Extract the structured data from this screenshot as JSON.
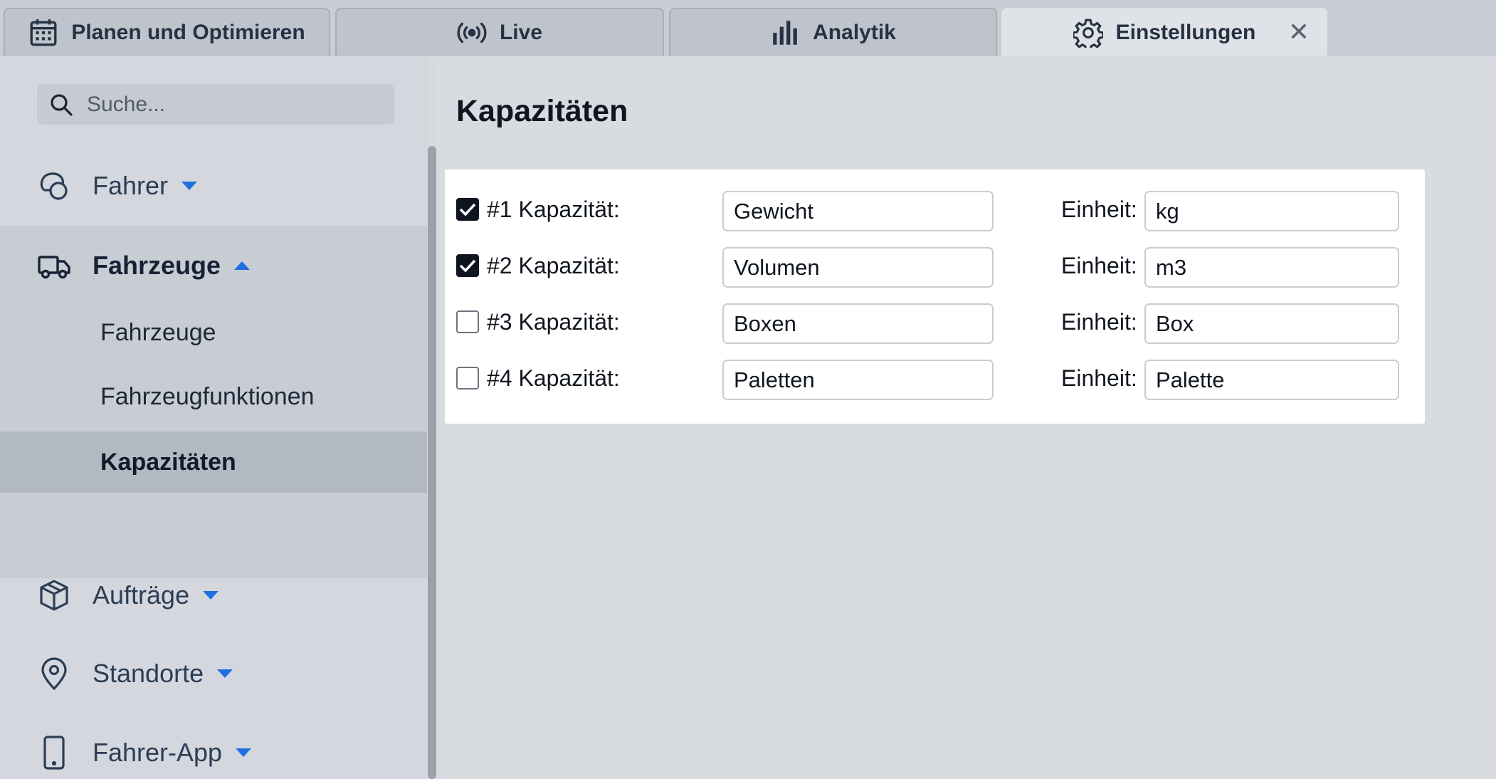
{
  "tabs": [
    {
      "label": "Planen und Optimieren",
      "icon": "calendar-icon",
      "active": false
    },
    {
      "label": "Live",
      "icon": "broadcast-icon",
      "active": false
    },
    {
      "label": "Analytik",
      "icon": "bar-chart-icon",
      "active": false
    },
    {
      "label": "Einstellungen",
      "icon": "gear-icon",
      "active": true
    }
  ],
  "tab_close_label": "✕",
  "sidebar": {
    "search_placeholder": "Suche...",
    "groups": [
      {
        "label": "Fahrer",
        "icon": "driver-icon",
        "expanded": false
      },
      {
        "label": "Fahrzeuge",
        "icon": "truck-icon",
        "expanded": true,
        "items": [
          {
            "label": "Fahrzeuge",
            "selected": false
          },
          {
            "label": "Fahrzeugfunktionen",
            "selected": false
          },
          {
            "label": "Kapazitäten",
            "selected": true
          }
        ]
      },
      {
        "label": "Aufträge",
        "icon": "package-icon",
        "expanded": false
      },
      {
        "label": "Standorte",
        "icon": "location-pin-icon",
        "expanded": false
      },
      {
        "label": "Fahrer-App",
        "icon": "smartphone-icon",
        "expanded": false
      }
    ]
  },
  "main": {
    "title": "Kapazitäten",
    "unit_label": "Einheit:",
    "capacities": [
      {
        "label": "#1 Kapazität:",
        "checked": true,
        "name": "Gewicht",
        "unit": "kg"
      },
      {
        "label": "#2 Kapazität:",
        "checked": true,
        "name": "Volumen",
        "unit": "m3"
      },
      {
        "label": "#3 Kapazität:",
        "checked": false,
        "name": "Boxen",
        "unit": "Box"
      },
      {
        "label": "#4 Kapazität:",
        "checked": false,
        "name": "Paletten",
        "unit": "Palette"
      }
    ]
  },
  "colors": {
    "caret": "#1f6fe0",
    "checkbox_checked": "#0f1520"
  }
}
